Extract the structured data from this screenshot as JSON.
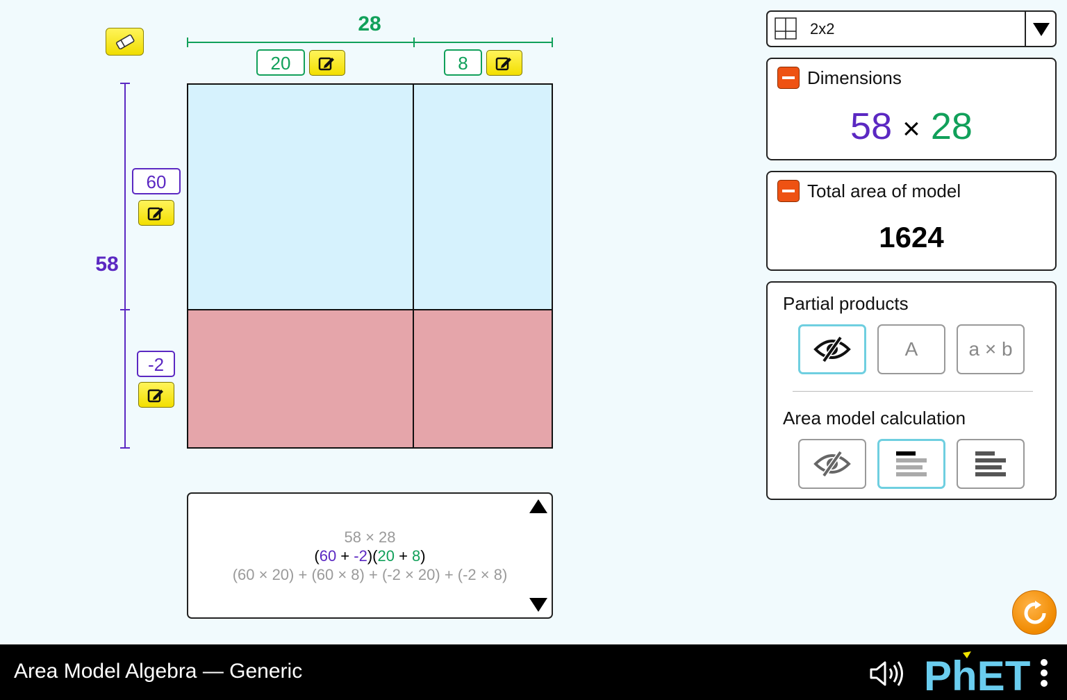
{
  "width": {
    "total": "28",
    "parts": [
      "20",
      "8"
    ]
  },
  "height": {
    "total": "58",
    "parts": [
      "60",
      "-2"
    ]
  },
  "layout": {
    "selected": "2x2"
  },
  "dimensions_panel": {
    "title": "Dimensions",
    "height": "58",
    "times": "×",
    "width": "28"
  },
  "total_area_panel": {
    "title": "Total area of model",
    "value": "1624"
  },
  "partial_products": {
    "title": "Partial products",
    "options": [
      "A",
      "a × b"
    ]
  },
  "area_calc": {
    "title": "Area model calculation"
  },
  "calculation": {
    "line1": "58 × 28",
    "line2": {
      "open1": "(",
      "h1": "60",
      "plus1": " + ",
      "h2": "-2",
      "close1": ")",
      "open2": "(",
      "w1": "20",
      "plus2": " + ",
      "w2": "8",
      "close2": ")"
    },
    "line3": "(60 × 20) + (60 × 8) + (-2 × 20) + (-2 × 8)"
  },
  "navbar": {
    "title": "Area Model Algebra — Generic",
    "brand": "PhET"
  },
  "colors": {
    "positive_cell": "#d6f2fd",
    "negative_cell": "#e5a5aa",
    "width_accent": "#11a05a",
    "height_accent": "#5b28c2"
  }
}
